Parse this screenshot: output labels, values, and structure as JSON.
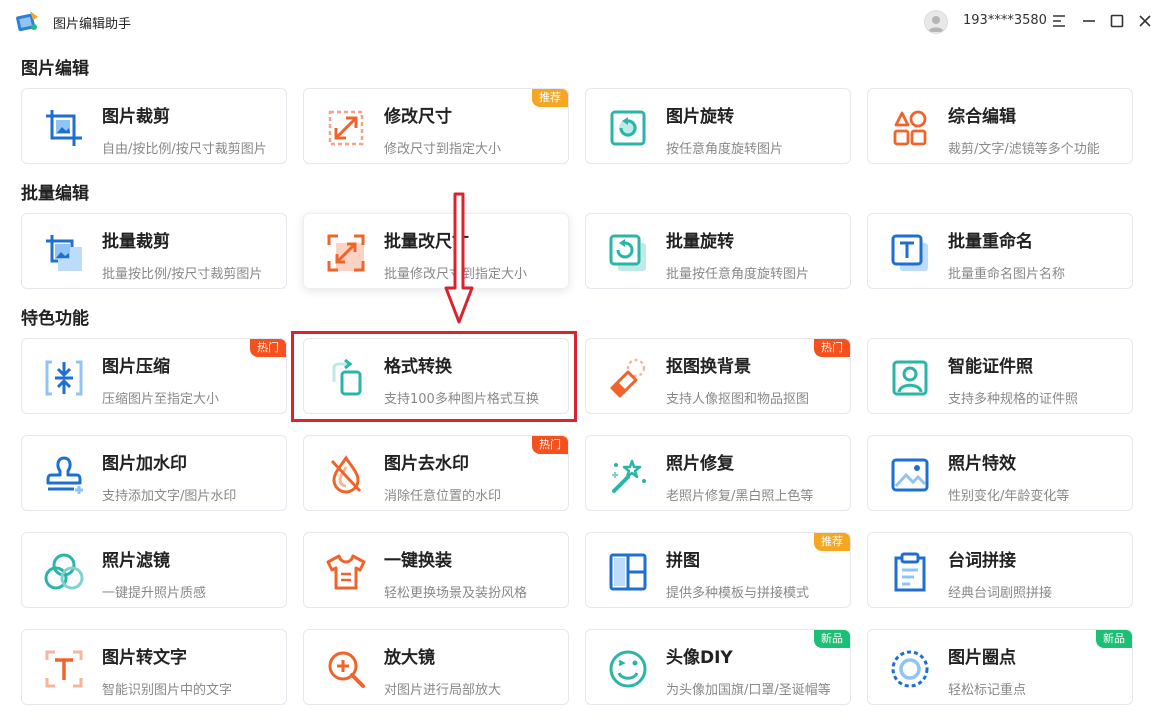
{
  "app": {
    "title": "图片编辑助手"
  },
  "user": {
    "phone": "193****3580"
  },
  "sections": [
    {
      "title": "图片编辑"
    },
    {
      "title": "批量编辑"
    },
    {
      "title": "特色功能"
    }
  ],
  "cards": [
    {
      "title": "图片裁剪",
      "desc": "自由/按比例/按尺寸裁剪图片",
      "icon": "crop-icon",
      "badge": ""
    },
    {
      "title": "修改尺寸",
      "desc": "修改尺寸到指定大小",
      "icon": "resize-icon",
      "badge": "推荐"
    },
    {
      "title": "图片旋转",
      "desc": "按任意角度旋转图片",
      "icon": "rotate-icon",
      "badge": ""
    },
    {
      "title": "综合编辑",
      "desc": "裁剪/文字/滤镜等多个功能",
      "icon": "shapes-icon",
      "badge": ""
    },
    {
      "title": "批量裁剪",
      "desc": "批量按比例/按尺寸裁剪图片",
      "icon": "batch-crop-icon",
      "badge": ""
    },
    {
      "title": "批量改尺寸",
      "desc": "批量修改尺寸到指定大小",
      "icon": "batch-resize-icon",
      "badge": ""
    },
    {
      "title": "批量旋转",
      "desc": "批量按任意角度旋转图片",
      "icon": "batch-rotate-icon",
      "badge": ""
    },
    {
      "title": "批量重命名",
      "desc": "批量重命名图片名称",
      "icon": "rename-icon",
      "badge": ""
    },
    {
      "title": "图片压缩",
      "desc": "压缩图片至指定大小",
      "icon": "compress-icon",
      "badge": "热门"
    },
    {
      "title": "格式转换",
      "desc": "支持100多种图片格式互换",
      "icon": "format-convert-icon",
      "badge": ""
    },
    {
      "title": "抠图换背景",
      "desc": "支持人像抠图和物品抠图",
      "icon": "eraser-icon",
      "badge": "热门"
    },
    {
      "title": "智能证件照",
      "desc": "支持多种规格的证件照",
      "icon": "id-photo-icon",
      "badge": ""
    },
    {
      "title": "图片加水印",
      "desc": "支持添加文字/图片水印",
      "icon": "stamp-icon",
      "badge": ""
    },
    {
      "title": "图片去水印",
      "desc": "消除任意位置的水印",
      "icon": "drop-slash-icon",
      "badge": "热门"
    },
    {
      "title": "照片修复",
      "desc": "老照片修复/黑白照上色等",
      "icon": "magic-wand-icon",
      "badge": ""
    },
    {
      "title": "照片特效",
      "desc": "性别变化/年龄变化等",
      "icon": "picture-icon",
      "badge": ""
    },
    {
      "title": "照片滤镜",
      "desc": "一键提升照片质感",
      "icon": "filter-icon",
      "badge": ""
    },
    {
      "title": "一键换装",
      "desc": "轻松更换场景及装扮风格",
      "icon": "shirt-icon",
      "badge": ""
    },
    {
      "title": "拼图",
      "desc": "提供多种模板与拼接模式",
      "icon": "collage-icon",
      "badge": "推荐"
    },
    {
      "title": "台词拼接",
      "desc": "经典台词剧照拼接",
      "icon": "clipboard-icon",
      "badge": ""
    },
    {
      "title": "图片转文字",
      "desc": "智能识别图片中的文字",
      "icon": "text-recognition-icon",
      "badge": ""
    },
    {
      "title": "放大镜",
      "desc": "对图片进行局部放大",
      "icon": "zoom-in-icon",
      "badge": ""
    },
    {
      "title": "头像DIY",
      "desc": "为头像加国旗/口罩/圣诞帽等",
      "icon": "smiley-icon",
      "badge": "新品"
    },
    {
      "title": "图片圈点",
      "desc": "轻松标记重点",
      "icon": "circle-mark-icon",
      "badge": "新品"
    }
  ],
  "colors": {
    "accent_red": "#d9232e",
    "badge_orange": "#f5a623",
    "badge_red": "#f4511e",
    "badge_green": "#1cbf73",
    "icon_blue": "#1d6fd1",
    "icon_orange": "#f0642b",
    "icon_teal": "#2ab5a9"
  }
}
